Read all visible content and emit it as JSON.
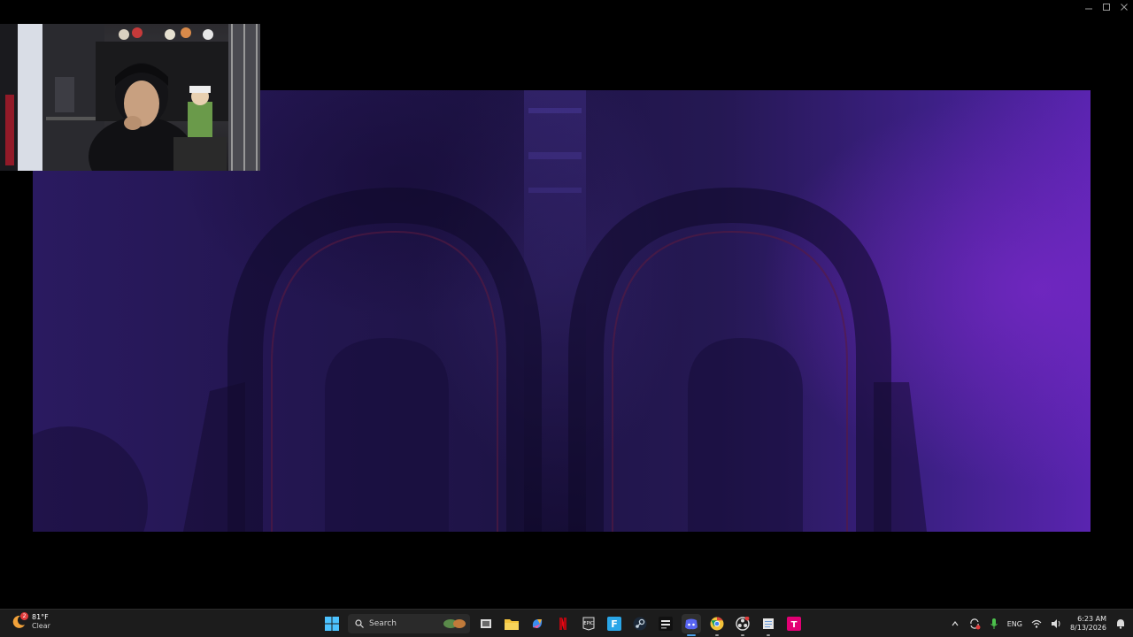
{
  "window": {
    "minimize_icon": "minimize-icon",
    "maximize_icon": "maximize-icon",
    "close_icon": "close-icon"
  },
  "game": {
    "scene": "dark-purple-gothic-arches",
    "colors": {
      "base": "#231650",
      "glow": "#5a24b0",
      "accent": "#a0285a"
    }
  },
  "webcam": {
    "subject": "streamer-webcam"
  },
  "taskbar": {
    "weather": {
      "temp": "81°F",
      "condition": "Clear",
      "badge": "2"
    },
    "search": {
      "placeholder": "Search"
    },
    "apps": [
      {
        "name": "start-icon"
      },
      {
        "name": "task-view-icon"
      },
      {
        "name": "file-explorer-icon"
      },
      {
        "name": "copilot-icon"
      },
      {
        "name": "netflix-icon"
      },
      {
        "name": "epic-games-icon"
      },
      {
        "name": "fortnite-icon"
      },
      {
        "name": "steam-icon"
      },
      {
        "name": "call-of-duty-icon"
      },
      {
        "name": "discord-icon"
      },
      {
        "name": "chrome-icon"
      },
      {
        "name": "obs-icon"
      },
      {
        "name": "notepad-icon"
      },
      {
        "name": "tmobile-icon"
      }
    ],
    "tray": {
      "language": "ENG",
      "time": "6:23 AM",
      "date": "8/13/2026"
    },
    "colors": {
      "background": "#1c1c1c",
      "accent": "#4ca0e8"
    }
  }
}
